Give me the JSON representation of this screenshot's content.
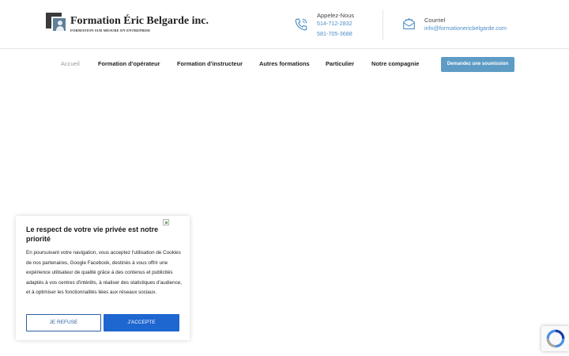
{
  "brand": {
    "name": "Formation Éric Belgarde inc.",
    "tagline": "FORMATION SUR MESURE EN ENTREPRISE"
  },
  "contact": {
    "phone_label": "Appelez-Nous",
    "phone_1": "514-712-2832",
    "phone_2": "581-705-3688",
    "email_label": "Courriel",
    "email": "info@formationericbelgarde.com"
  },
  "nav": {
    "items": [
      {
        "label": "Accueil"
      },
      {
        "label": "Formation d'opérateur"
      },
      {
        "label": "Formation d'instructeur"
      },
      {
        "label": "Autres formations"
      },
      {
        "label": "Particulier"
      },
      {
        "label": "Notre compagnie"
      }
    ],
    "cta": "Demandez une soumission"
  },
  "cookie": {
    "title": "Le respect de votre vie privée est notre priorité",
    "body": "En poursuivant votre navigation, vous acceptez l'utilisation de Cookies de nos partenaires, Google Facebook, destinés à vous offrir une expérience utilisateur de qualité grâce à des contenus et publicités adaptés à vos centres d'intérêts, à réaliser des statistiques d'audience, et à optimiser les fonctionnalités liées aux réseaux sociaux.",
    "refuse": "JE REFUSE",
    "accept": "J'ACCEPTE"
  },
  "icons": {
    "phone": "phone-icon",
    "mail": "mail-icon",
    "close": "broken-image-icon",
    "recaptcha": "recaptcha-icon"
  },
  "colors": {
    "link": "#4e8fc7",
    "cta": "#5f9cc5",
    "accept": "#1e66d0",
    "refuse_border": "#2d5f9e"
  }
}
